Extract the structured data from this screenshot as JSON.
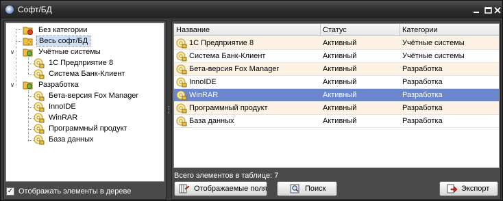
{
  "window": {
    "title": "Софт/БД"
  },
  "tree": {
    "nodes": [
      {
        "label": "Без категории"
      },
      {
        "label": "Весь софт/БД"
      },
      {
        "label": "Учётные системы"
      },
      {
        "label": "1С Предприятие 8"
      },
      {
        "label": "Система Банк-Клиент"
      },
      {
        "label": "Разработка"
      },
      {
        "label": "Бета-версия Fox Manager"
      },
      {
        "label": "InnoIDE"
      },
      {
        "label": "WinRAR"
      },
      {
        "label": "Программный продукт"
      },
      {
        "label": "База данных"
      }
    ],
    "selected_index": 1,
    "show_in_tree_label": "Отображать элементы в дереве",
    "show_in_tree_checked": true
  },
  "grid": {
    "columns": [
      "Название",
      "Статус",
      "Категории"
    ],
    "rows": [
      {
        "name": "1С Предприятие 8",
        "status": "Активный",
        "category": "Учётные системы"
      },
      {
        "name": "Система Банк-Клиент",
        "status": "Активный",
        "category": "Учётные системы"
      },
      {
        "name": "Бета-версия Fox Manager",
        "status": "Активный",
        "category": "Разработка"
      },
      {
        "name": "InnoIDE",
        "status": "Активный",
        "category": "Разработка"
      },
      {
        "name": "WinRAR",
        "status": "Активный",
        "category": "Разработка"
      },
      {
        "name": "Программный продукт",
        "status": "Активный",
        "category": "Разработка"
      },
      {
        "name": "База данных",
        "status": "Активный",
        "category": "Разработка"
      }
    ],
    "selected_row": 4,
    "total_text": "Всего элементов в таблице: 7"
  },
  "buttons": {
    "fields": "Отображаемые поля",
    "search": "Поиск",
    "export": "Экспорт"
  },
  "colors": {
    "row_odd": "#fdf2e3",
    "row_selected": "#6a86cc",
    "tree_selected": "#cfe0f6"
  }
}
